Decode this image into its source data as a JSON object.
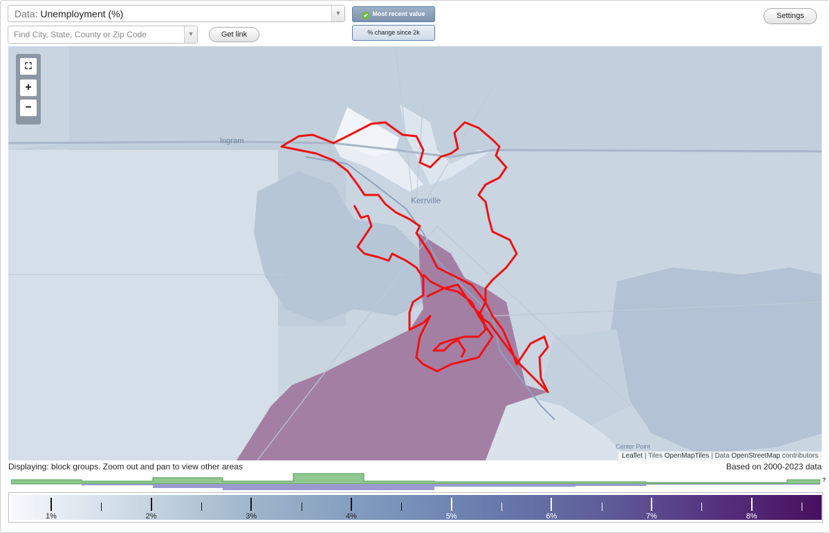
{
  "controls": {
    "data_prefix": "Data: ",
    "data_value": "Unemployment (%)",
    "search_placeholder": "Find City, State, County or Zip Code",
    "get_link_label": "Get link",
    "settings_label": "Settings",
    "toggle_recent_label": "Most recent value",
    "toggle_change_label": "% change since 2k"
  },
  "icons": {
    "dropdown": "chevron-down-icon",
    "check": "check-icon",
    "fullscreen": "fullscreen-icon",
    "zoom_in": "plus-icon",
    "zoom_out": "minus-icon"
  },
  "map": {
    "labels": {
      "ingram": "Ingram",
      "kerrville": "Kerrville",
      "center_point": "Center Point"
    },
    "attribution": {
      "leaflet": "Leaflet",
      "sep1": " | Tiles ",
      "tiles": "OpenMapTiles",
      "sep2": " | Data ",
      "data": "OpenStreetMap",
      "tail": " contributors"
    },
    "colors": {
      "city_outline": "#ee1111",
      "high_area": "#a47fa4",
      "low_area": "#f0f3f7"
    }
  },
  "display_note": "Displaying: block groups. Zoom out and pan to view other areas",
  "based_on": "Based on 2000-2023 data",
  "histogram_help": "?",
  "legend": {
    "labels": [
      "1%",
      "2%",
      "3%",
      "4%",
      "5%",
      "6%",
      "7%",
      "8%"
    ],
    "min": 0.6,
    "max": 8.7
  }
}
